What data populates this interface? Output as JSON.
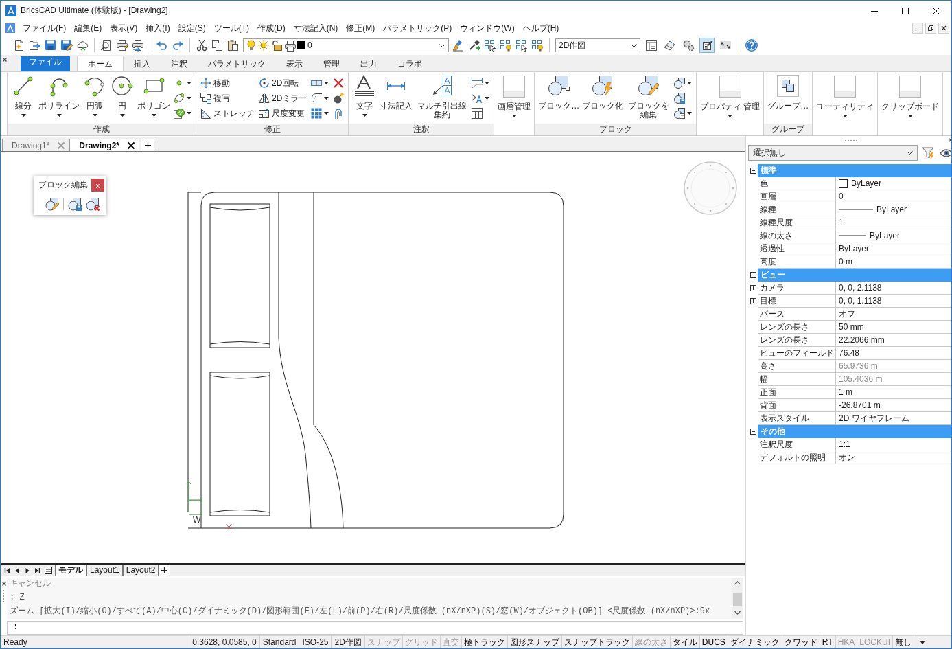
{
  "window": {
    "title": "BricsCAD Ultimate (体験版) - [Drawing2]"
  },
  "menu_bar": {
    "items": [
      "ファイル(F)",
      "編集(E)",
      "表示(V)",
      "挿入(I)",
      "設定(S)",
      "ツール(T)",
      "作成(D)",
      "寸法記入(N)",
      "修正(M)",
      "パラメトリック(P)",
      "ウィンドウ(W)",
      "ヘルプ(H)"
    ]
  },
  "toolbar": {
    "layer": "0",
    "workspace": "2D作図",
    "view_buttons": [
      {
        "pressed": false
      },
      {
        "pressed": false
      },
      {
        "pressed": false
      },
      {
        "pressed": true
      },
      {
        "pressed": false
      }
    ]
  },
  "ribbon": {
    "tabs": [
      {
        "label": "ファイル",
        "kind": "application",
        "selected": false
      },
      {
        "label": "ホーム",
        "kind": "tab",
        "selected": true
      },
      {
        "label": "挿入",
        "kind": "tab",
        "selected": false
      },
      {
        "label": "注釈",
        "kind": "tab",
        "selected": false
      },
      {
        "label": "パラメトリック",
        "kind": "tab",
        "selected": false
      },
      {
        "label": "表示",
        "kind": "tab",
        "selected": false
      },
      {
        "label": "管理",
        "kind": "tab",
        "selected": false
      },
      {
        "label": "出力",
        "kind": "tab",
        "selected": false
      },
      {
        "label": "コラボ",
        "kind": "tab",
        "selected": false
      }
    ],
    "panels": [
      {
        "kind": "full",
        "title": "作成",
        "groups": [
          {
            "kind": "large",
            "label": "線分",
            "menu": true
          },
          {
            "kind": "large",
            "label": "ポリライン",
            "menu": true
          },
          {
            "kind": "large",
            "label": "円弧",
            "menu": true
          },
          {
            "kind": "large",
            "label": "円",
            "menu": true
          },
          {
            "kind": "large",
            "label": "ポリゴン",
            "menu": true
          },
          {
            "kind": "column",
            "items": [
              {
                "menu": true
              },
              {
                "menu": true
              },
              {
                "menu": true
              }
            ]
          }
        ]
      },
      {
        "kind": "full",
        "title": "修正",
        "groups": [
          {
            "kind": "column",
            "items": [
              {
                "label": "移動",
                "menu": false
              },
              {
                "label": "複写",
                "menu": false
              },
              {
                "label": "ストレッチ",
                "menu": false
              }
            ]
          },
          {
            "kind": "column",
            "items": [
              {
                "label": "2D回転",
                "menu": false
              },
              {
                "label": "2Dミラー",
                "menu": false
              },
              {
                "label": "尺度変更",
                "menu": false
              }
            ]
          },
          {
            "kind": "column",
            "items": [
              {
                "menu": true
              },
              {
                "menu": true
              },
              {
                "menu": true
              }
            ]
          },
          {
            "kind": "column",
            "items": [
              {
                "menu": false
              },
              {
                "menu": false
              },
              {
                "menu": false
              }
            ]
          }
        ]
      },
      {
        "kind": "full",
        "title": "注釈",
        "groups": [
          {
            "kind": "large",
            "label": "文字",
            "menu": true
          },
          {
            "kind": "large",
            "label": "寸法記入",
            "menu": false
          },
          {
            "kind": "large",
            "label": "マルチ引出線集約",
            "menu": false
          },
          {
            "kind": "column",
            "items": [
              {
                "menu": true
              },
              {
                "menu": true
              },
              {
                "menu": false
              }
            ]
          }
        ]
      },
      {
        "kind": "collapsed",
        "label": "画層管理"
      },
      {
        "kind": "full",
        "title": "ブロック",
        "groups": [
          {
            "kind": "large",
            "label": "ブロック…",
            "menu": false
          },
          {
            "kind": "large",
            "label": "ブロック化",
            "menu": false
          },
          {
            "kind": "large",
            "label": "ブロックを編集",
            "menu": false
          },
          {
            "kind": "column",
            "items": [
              {
                "menu": true
              },
              {
                "menu": false
              },
              {
                "menu": true
              }
            ]
          }
        ]
      },
      {
        "kind": "collapsed",
        "label": "プロパティ 管理"
      },
      {
        "kind": "full",
        "title": "グループ",
        "groups": [
          {
            "kind": "large",
            "label": "グループ…",
            "menu": false
          }
        ]
      },
      {
        "kind": "collapsed",
        "label": "ユーティリティ"
      },
      {
        "kind": "collapsed",
        "label": "クリップボード"
      }
    ]
  },
  "document_tabs": [
    {
      "label": "Drawing1*",
      "selected": false
    },
    {
      "label": "Drawing2*",
      "selected": true
    }
  ],
  "block_edit": {
    "title": "ブロック編集",
    "close": "x"
  },
  "canvas": {
    "ucs_label": "W"
  },
  "layout_tabs": [
    {
      "label": "モデル",
      "selected": true
    },
    {
      "label": "Layout1",
      "selected": false
    },
    {
      "label": "Layout2",
      "selected": false
    }
  ],
  "command_line": {
    "history": [
      {
        "text": "キャンセル",
        "kind": "muted"
      },
      {
        "text": ": Z",
        "kind": "normal"
      },
      {
        "text": "ズーム [拡大(I)/縮小(O)/すべて(A)/中心(C)/ダイナミック(D)/図形範囲(E)/左(L)/前(P)/右(R)/尺度係数 (nX/nXP)(S)/窓(W)/オブジェクト(OB)] <尺度係数 (nX/nXP)>:9x",
        "kind": "normal"
      }
    ],
    "prompt": ":"
  },
  "properties": {
    "selection": "選択無し",
    "groups": [
      {
        "title": "標準",
        "expanded": true,
        "rows": [
          {
            "label": "色",
            "value": "ByLayer",
            "kind": "color",
            "disabled": false
          },
          {
            "label": "画層",
            "value": "0",
            "kind": "text",
            "disabled": false
          },
          {
            "label": "線種",
            "value": "ByLayer",
            "kind": "linetype",
            "disabled": false
          },
          {
            "label": "線種尺度",
            "value": "1",
            "kind": "text",
            "disabled": false
          },
          {
            "label": "線の太さ",
            "value": "ByLayer",
            "kind": "lineweight",
            "disabled": false
          },
          {
            "label": "透過性",
            "value": "ByLayer",
            "kind": "text",
            "disabled": false
          },
          {
            "label": "高度",
            "value": "0 m",
            "kind": "text",
            "disabled": false
          }
        ]
      },
      {
        "title": "ビュー",
        "expanded": true,
        "rows": [
          {
            "label": "カメラ",
            "value": "0, 0, 2.1138",
            "kind": "expandable",
            "disabled": false
          },
          {
            "label": "目標",
            "value": "0, 0, 1.1138",
            "kind": "expandable",
            "disabled": false
          },
          {
            "label": "パース",
            "value": "オフ",
            "kind": "text",
            "disabled": false
          },
          {
            "label": "レンズの長さ",
            "value": "50 mm",
            "kind": "text",
            "disabled": false
          },
          {
            "label": "レンズの長さ",
            "value": "22.2066 mm",
            "kind": "text",
            "disabled": false
          },
          {
            "label": "ビューのフィールド",
            "value": "76.48",
            "kind": "text",
            "disabled": false
          },
          {
            "label": "高さ",
            "value": "65.9736 m",
            "kind": "text",
            "disabled": true
          },
          {
            "label": "幅",
            "value": "105.4036 m",
            "kind": "text",
            "disabled": true
          },
          {
            "label": "正面",
            "value": "1 m",
            "kind": "text",
            "disabled": false
          },
          {
            "label": "背面",
            "value": "-26.8701 m",
            "kind": "text",
            "disabled": false
          },
          {
            "label": "表示スタイル",
            "value": "2D ワイヤフレーム",
            "kind": "text",
            "disabled": false
          }
        ]
      },
      {
        "title": "その他",
        "expanded": true,
        "rows": [
          {
            "label": "注釈尺度",
            "value": "1:1",
            "kind": "text",
            "disabled": false
          },
          {
            "label": "デフォルトの照明",
            "value": "オン",
            "kind": "text",
            "disabled": false
          }
        ]
      }
    ]
  },
  "status_bar": {
    "message": "Ready",
    "coordinates": "0.3628, 0.0585, 0",
    "fields": [
      "Standard",
      "ISO-25",
      "2D作図"
    ],
    "toggles": [
      {
        "label": "スナップ",
        "on": false
      },
      {
        "label": "グリッド",
        "on": false
      },
      {
        "label": "直交",
        "on": false
      },
      {
        "label": "極トラック",
        "on": true
      },
      {
        "label": "図形スナップ",
        "on": true
      },
      {
        "label": "スナップトラック",
        "on": true
      },
      {
        "label": "線の太さ",
        "on": false
      },
      {
        "label": "タイル",
        "on": true
      },
      {
        "label": "DUCS",
        "on": true
      },
      {
        "label": "ダイナミック",
        "on": true
      },
      {
        "label": "クワッド",
        "on": true
      },
      {
        "label": "RT",
        "on": true
      },
      {
        "label": "HKA",
        "on": false
      },
      {
        "label": "LOCKUI",
        "on": false
      },
      {
        "label": "無し",
        "on": true
      }
    ]
  }
}
